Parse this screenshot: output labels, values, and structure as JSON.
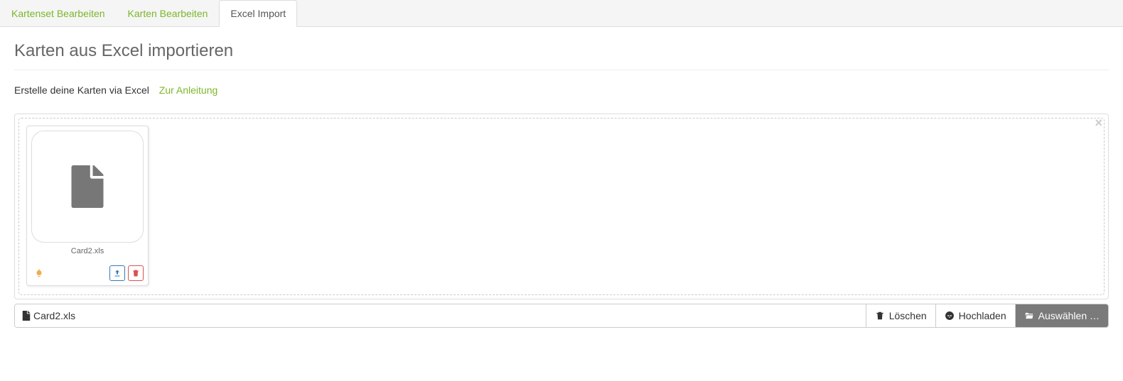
{
  "tabs": [
    {
      "label": "Kartenset Bearbeiten",
      "active": false
    },
    {
      "label": "Karten Bearbeiten",
      "active": false
    },
    {
      "label": "Excel Import",
      "active": true
    }
  ],
  "page": {
    "title": "Karten aus Excel importieren",
    "subtitle": "Erstelle deine Karten via Excel",
    "guide_link": "Zur Anleitung"
  },
  "dropzone": {
    "files": [
      {
        "name": "Card2.xls"
      }
    ]
  },
  "bottom": {
    "filename": "Card2.xls",
    "delete_label": "Löschen",
    "upload_label": "Hochladen",
    "select_label": "Auswählen …"
  }
}
